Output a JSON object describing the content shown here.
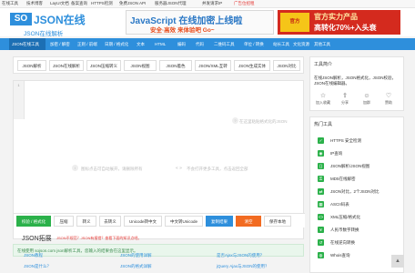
{
  "topbar": {
    "links": [
      "在线工具",
      "技术博客",
      "LayUI文档",
      "备案查询",
      "HTTPS检测",
      "免费JSON API",
      "服务器JSON代理",
      "并发请求IP"
    ],
    "ad_link": "广告位招租"
  },
  "logo": {
    "badge": "SO",
    "title": "JSON在线",
    "subtitle": "JSON在线解析"
  },
  "ad1": {
    "line1": "JavaScript 在线加密上线啦",
    "line2": "安全·高效  来体验吧  Go~"
  },
  "ad2": {
    "badge": "官方",
    "line1": "官方实力产品",
    "line2": "高转化70%+入头衰"
  },
  "nav": {
    "items": [
      "JSON在线工具",
      "加密 / 解密",
      "正则 / 前端",
      "日期 / 格式化",
      "文本",
      "HTML",
      "编码",
      "代码",
      "二维码工具",
      "单位 / 转换",
      "站长工具",
      "文化资源",
      "其他工具"
    ]
  },
  "tabs": [
    "JSON解析",
    "JSON在线解析",
    "JSON压缩转义",
    "JSON视图",
    "JSON着色",
    "JSON/XML互转",
    "JSON生成实体",
    "JSON对比"
  ],
  "editor": {
    "line_no": "1",
    "placeholder_top": "在这里粘贴格式化的JSON",
    "placeholder_left": "图标点击可自动展开，请删除所有",
    "placeholder_right": "不会打开更多工具，点击返回全部",
    "arrows": "« »"
  },
  "buttons": [
    "校验 / 格式化",
    "压缩",
    "转义",
    "去转义",
    "Unicode转中文",
    "中文转Unicode",
    "复制结果",
    "清空",
    "保存本地"
  ],
  "notice": "在线使用 sojson.com json解析工具，您输入的结果会在这里显示。",
  "extension": {
    "title": "JSON拓展",
    "subtitle": "JSON不规范？JSON有报错？查看下面的知识点吧。",
    "links": [
      "JSON教程",
      "JSON的使用详解",
      "JSON是什么？",
      "JSON的格式详解",
      "是否Ajax与JSON的使用？",
      "jQuery Ajax与JSON的使用？"
    ]
  },
  "sidebar": {
    "intro_title": "工具简介",
    "intro_desc": "在线JSON解析，JSON格式化，JSON校验，JSON在线编辑器。",
    "actions": [
      "加入收藏",
      "分享",
      "加群",
      "赞助"
    ],
    "hot_title": "热门工具",
    "tools": [
      "HTTPS 安全检测",
      "IP查询",
      "JSON解析/JSON视图",
      "MD5在线解密",
      "JSON对比，2个JSON对比",
      "ASCII码表",
      "XML压缩/格式化",
      "人民币数字转换",
      "在线逆向转换",
      "Whois查询"
    ]
  },
  "colors": {
    "brand": "#2e8fdc",
    "green": "#2bb14a",
    "orange": "#f26b21",
    "red": "#e53935"
  }
}
